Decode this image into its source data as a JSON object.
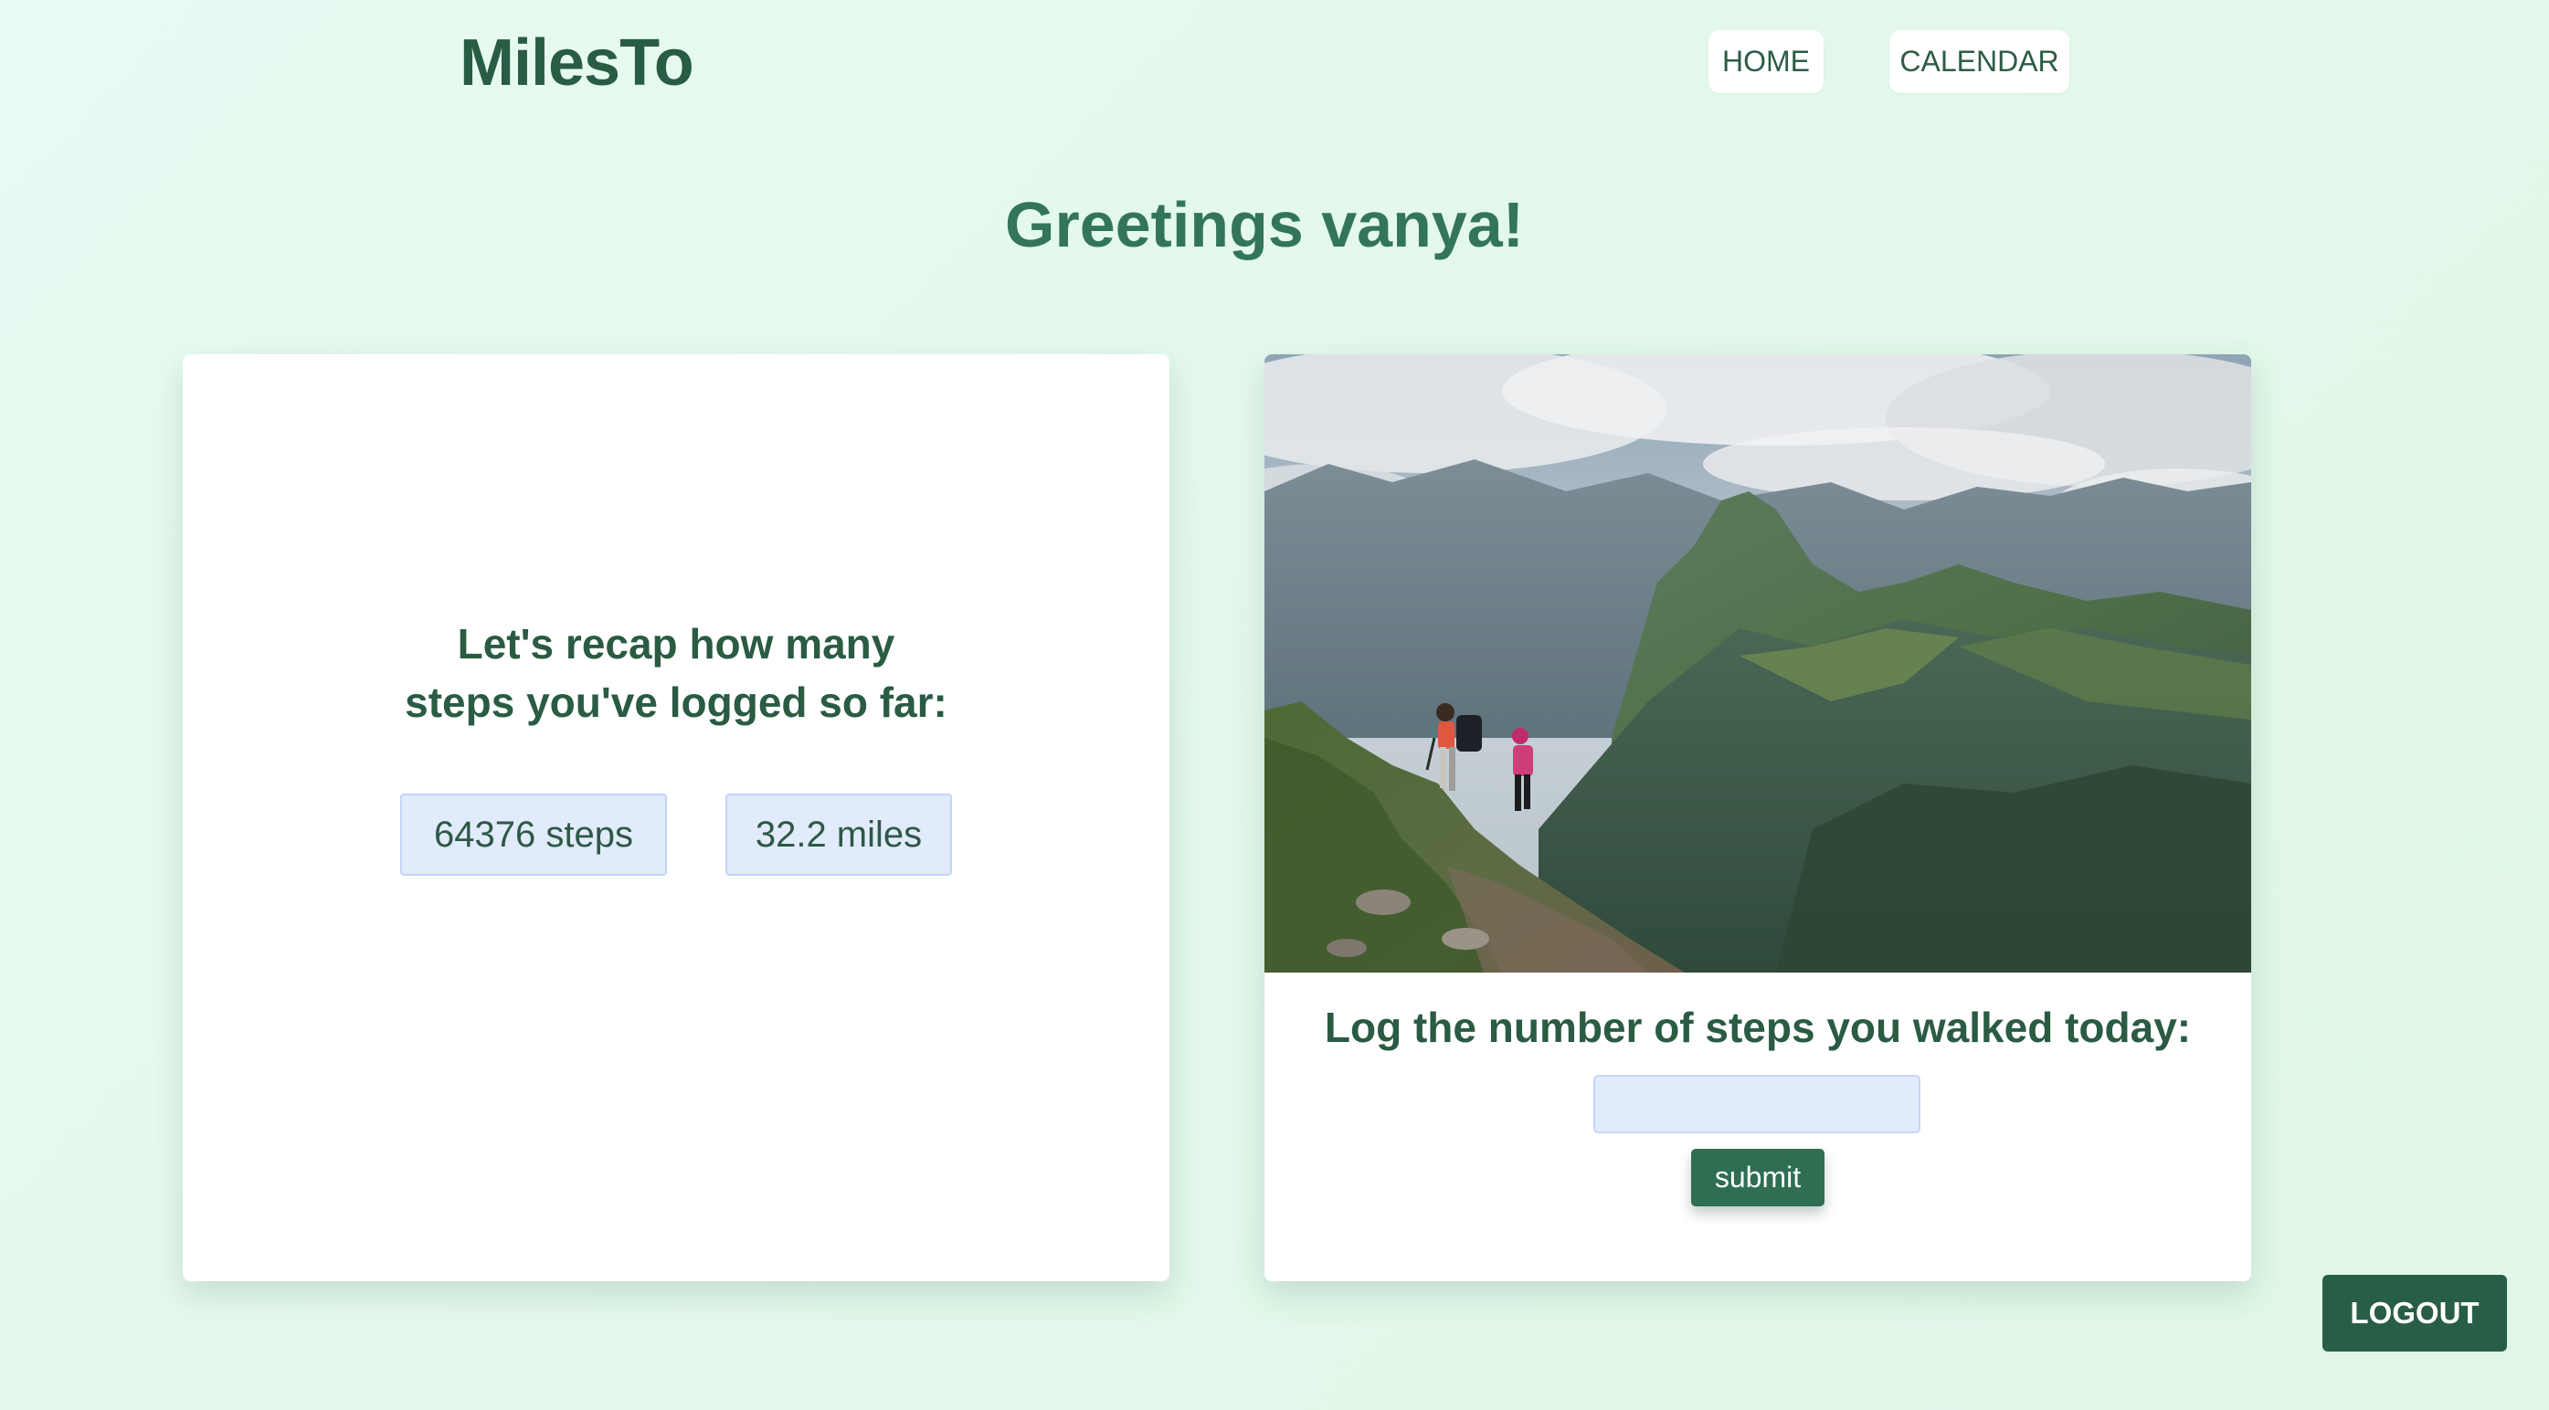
{
  "header": {
    "brand": "MilesTo",
    "nav": {
      "home": "HOME",
      "calendar": "CALENDAR"
    }
  },
  "greeting": "Greetings vanya!",
  "recap": {
    "title_line1": "Let's recap how many",
    "title_line2": "steps you've logged so far:",
    "steps": "64376 steps",
    "miles": "32.2 miles"
  },
  "log": {
    "title": "Log the number of steps you walked today:",
    "input_value": "",
    "input_placeholder": "",
    "submit_label": "submit"
  },
  "logout_label": "LOGOUT",
  "colors": {
    "brand_green": "#285c43",
    "accent_green": "#2f6e51",
    "badge_blue": "#e1ebfc",
    "background": "#e2f8ea"
  },
  "photo": {
    "subject": "two-hikers-on-mountain-ridge"
  }
}
